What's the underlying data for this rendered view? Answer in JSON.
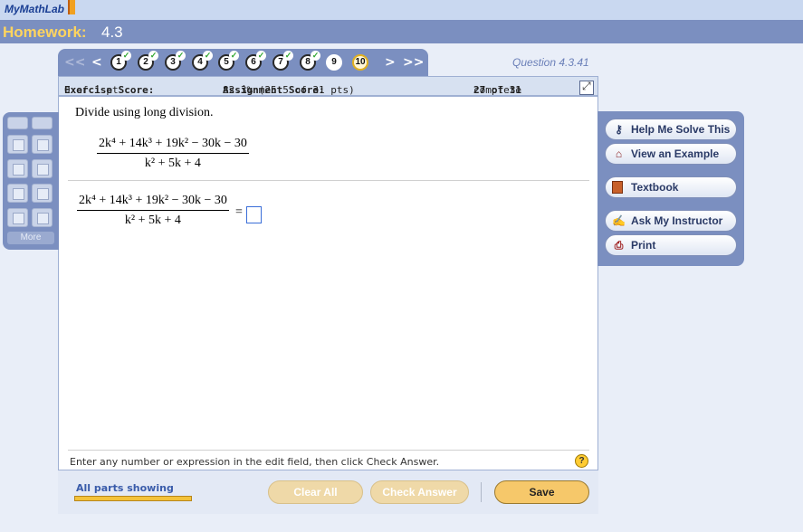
{
  "brand": {
    "logo_text": "MyMathLab"
  },
  "homework": {
    "title": "Homework:",
    "number": "4.3"
  },
  "nav": {
    "first": "<<",
    "prev": "<",
    "next": ">",
    "last": ">>",
    "questions": [
      {
        "label": "1",
        "done": true
      },
      {
        "label": "2",
        "done": true
      },
      {
        "label": "3",
        "done": true
      },
      {
        "label": "4",
        "done": true
      },
      {
        "label": "5",
        "done": true
      },
      {
        "label": "6",
        "done": true
      },
      {
        "label": "7",
        "done": true
      },
      {
        "label": "8",
        "done": true
      },
      {
        "label": "9",
        "done": false
      },
      {
        "label": "10",
        "done": false,
        "current": true
      }
    ],
    "question_id": "Question 4.3.41"
  },
  "score": {
    "exercise_label": "Exercise Score:",
    "exercise_value": "0 of 1 pt",
    "assignment_label": "Assignment Score:",
    "assignment_value": "82.3% (25.5 of 31 pts)",
    "progress_count": "27 of 31",
    "progress_label": "complete"
  },
  "problem": {
    "prompt": "Divide using long division.",
    "numerator": "2k⁴ + 14k³ + 19k² − 30k − 30",
    "denominator": "k² + 5k + 4",
    "equals": "="
  },
  "hint": "Enter any number or expression in the edit field, then click Check Answer.",
  "help_icon": "?",
  "footer": {
    "parts_label": "All parts showing",
    "clear_all": "Clear All",
    "check_answer": "Check Answer",
    "save": "Save"
  },
  "tools": {
    "more_label": "More"
  },
  "help": {
    "solve": "Help Me Solve This",
    "example": "View an Example",
    "textbook": "Textbook",
    "instructor": "Ask My Instructor",
    "print": "Print"
  },
  "colors": {
    "header": "#7b8fc0",
    "title_accent": "#ffd45e",
    "button": "#f6c86a"
  }
}
